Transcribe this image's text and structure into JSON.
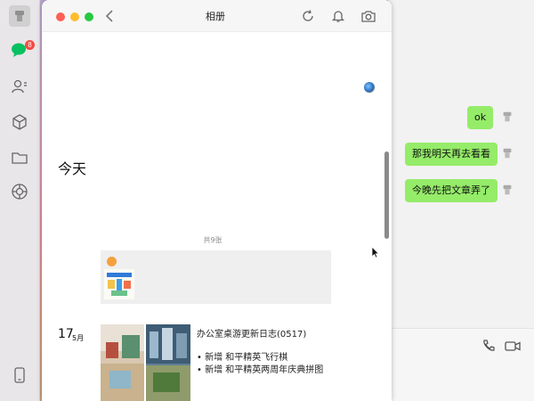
{
  "sidebar": {
    "unread_badge": "8",
    "icons": [
      "avatar-icon",
      "chat-icon",
      "contacts-icon",
      "cube-icon",
      "folder-icon",
      "moments-icon",
      "phone-icon"
    ]
  },
  "album": {
    "title": "相册",
    "today_label": "今天",
    "count_label": "共9张",
    "date_day": "17",
    "date_month": "5月",
    "post_title": "办公室桌游更新日志(0517)",
    "post_lines": [
      "• 新增 和平精英飞行棋",
      "• 新增 和平精英两周年庆典拼图"
    ]
  },
  "chat": {
    "messages": [
      "ok",
      "那我明天再去看看",
      "今晚先把文章弄了"
    ]
  },
  "colors": {
    "bubble_green": "#95ec69",
    "badge_red": "#f24b3f",
    "traffic_red": "#fe5f57",
    "traffic_yellow": "#febc2e",
    "traffic_green": "#28c840"
  }
}
